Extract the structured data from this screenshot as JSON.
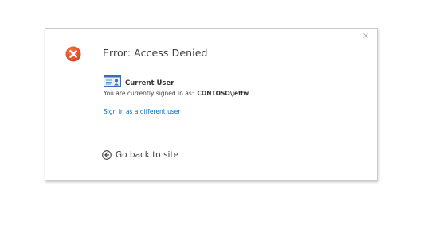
{
  "dialog": {
    "close_glyph": "×",
    "title": "Error: Access Denied",
    "error_icon": "error-x-icon",
    "colors": {
      "error_icon": "#e65125",
      "link": "#0072c6",
      "title": "#3d3d3d",
      "border": "#c8cad2"
    },
    "current_user": {
      "icon": "user-card-icon",
      "heading": "Current User",
      "signed_in_label": "You are currently signed in as:",
      "account": "CONTOSO\\jeffw"
    },
    "switch_user_link": "Sign in as a different user",
    "back": {
      "icon": "back-arrow-circle-icon",
      "label": "Go back to site"
    }
  }
}
